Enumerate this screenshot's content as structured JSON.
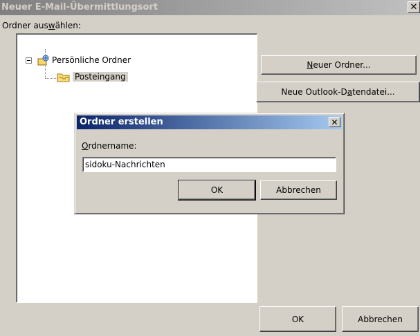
{
  "window": {
    "title": "Neuer E-Mail-Übermittlungsort",
    "close_glyph": "✕"
  },
  "folder_label": {
    "before": "Ordner aus",
    "accel": "w",
    "after": "ählen:"
  },
  "tree": {
    "root": {
      "label": "Persönliche Ordner",
      "icon": "personal-folders-icon"
    },
    "child": {
      "label": "Posteingang",
      "icon": "inbox-folder-icon"
    }
  },
  "side_buttons": {
    "new_folder": {
      "accel": "N",
      "rest": "euer Ordner..."
    },
    "new_datafile": {
      "before": "Neue Outlook-D",
      "accel": "a",
      "after": "tendatei..."
    }
  },
  "footer": {
    "ok": "OK",
    "cancel": "Abbrechen"
  },
  "modal": {
    "title": "Ordner erstellen",
    "close_glyph": "✕",
    "label": {
      "accel": "O",
      "rest": "rdnername:"
    },
    "input_value": "sidoku-Nachrichten",
    "ok": "OK",
    "cancel": "Abbrechen"
  },
  "colors": {
    "dialog_bg": "#d4d0c8",
    "active_title": "#0a246a",
    "inactive_title": "#808080"
  }
}
